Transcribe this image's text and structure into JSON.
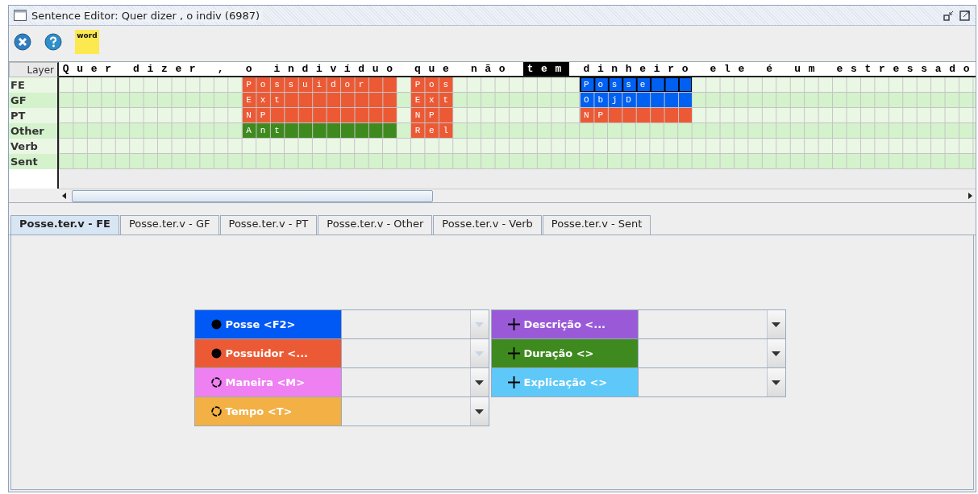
{
  "window": {
    "title": "Sentence Editor: Quer dizer , o indiv (6987)"
  },
  "toolbar": {
    "word_button": "word"
  },
  "grid": {
    "layer_header": "Layer",
    "layers": [
      {
        "name": "FE",
        "kind": "fe"
      },
      {
        "name": "GF",
        "kind": "gf"
      },
      {
        "name": "PT",
        "kind": "pt"
      },
      {
        "name": "Other",
        "kind": "other"
      },
      {
        "name": "Verb",
        "kind": "verb"
      },
      {
        "name": "Sent",
        "kind": "sent"
      }
    ],
    "sentence": [
      {
        "text": "Quer dizer ,",
        "selected": false
      },
      {
        "text": "o indivíduo",
        "selected": false,
        "labels": {
          "fe": {
            "text": "Possuidor",
            "color": "#ec5a35",
            "outlined": false
          },
          "gf": {
            "text": "Ext",
            "color": "#ec5a35",
            "outlined": false
          },
          "pt": {
            "text": "NP",
            "color": "#ec5a35",
            "outlined": false
          },
          "other": {
            "text": "Ant",
            "color": "#3f8a1f",
            "outlined": false
          }
        }
      },
      {
        "text": "que",
        "selected": false,
        "labels": {
          "fe": {
            "text": "Pos",
            "color": "#ec5a35",
            "outlined": false
          },
          "gf": {
            "text": "Ext",
            "color": "#ec5a35",
            "outlined": false
          },
          "pt": {
            "text": "NP",
            "color": "#ec5a35",
            "outlined": false
          },
          "other": {
            "text": "Rel",
            "color": "#ec5a35",
            "outlined": false
          }
        }
      },
      {
        "text": "não",
        "selected": false
      },
      {
        "text": "tem",
        "selected": true
      },
      {
        "text": "dinheiro",
        "selected": false,
        "labels": {
          "fe": {
            "text": "Posse",
            "color": "#0060f2",
            "outlined": true
          },
          "gf": {
            "text": "ObjD",
            "color": "#0060f2",
            "outlined": false
          },
          "pt": {
            "text": "NP",
            "color": "#ec5a35",
            "outlined": false
          }
        }
      },
      {
        "text": "ele é um estressado",
        "selected": false
      }
    ]
  },
  "tabs": [
    {
      "label": "Posse.ter.v - FE",
      "selected": true
    },
    {
      "label": "Posse.ter.v - GF",
      "selected": false
    },
    {
      "label": "Posse.ter.v - PT",
      "selected": false
    },
    {
      "label": "Posse.ter.v - Other",
      "selected": false
    },
    {
      "label": "Posse.ter.v - Verb",
      "selected": false
    },
    {
      "label": "Posse.ter.v - Sent",
      "selected": false
    }
  ],
  "frame_elements": {
    "left": [
      {
        "label": "Posse <F2>",
        "kind": "core",
        "color": "#0058f5",
        "disabled": true
      },
      {
        "label": "Possuidor <...",
        "kind": "core",
        "color": "#ec5a35",
        "disabled": true
      },
      {
        "label": "Maneira <M>",
        "kind": "peripheral",
        "color": "#ee80f2",
        "disabled": false
      },
      {
        "label": "Tempo <T>",
        "kind": "peripheral",
        "color": "#f3b044",
        "disabled": false
      }
    ],
    "right": [
      {
        "label": "Descrição <...",
        "kind": "extrathematic",
        "color": "#9a5ad8",
        "disabled": false
      },
      {
        "label": "Duração <>",
        "kind": "extrathematic",
        "color": "#3f8a1f",
        "disabled": false
      },
      {
        "label": "Explicação <>",
        "kind": "extrathematic",
        "color": "#5ec8f8",
        "disabled": false
      }
    ]
  }
}
